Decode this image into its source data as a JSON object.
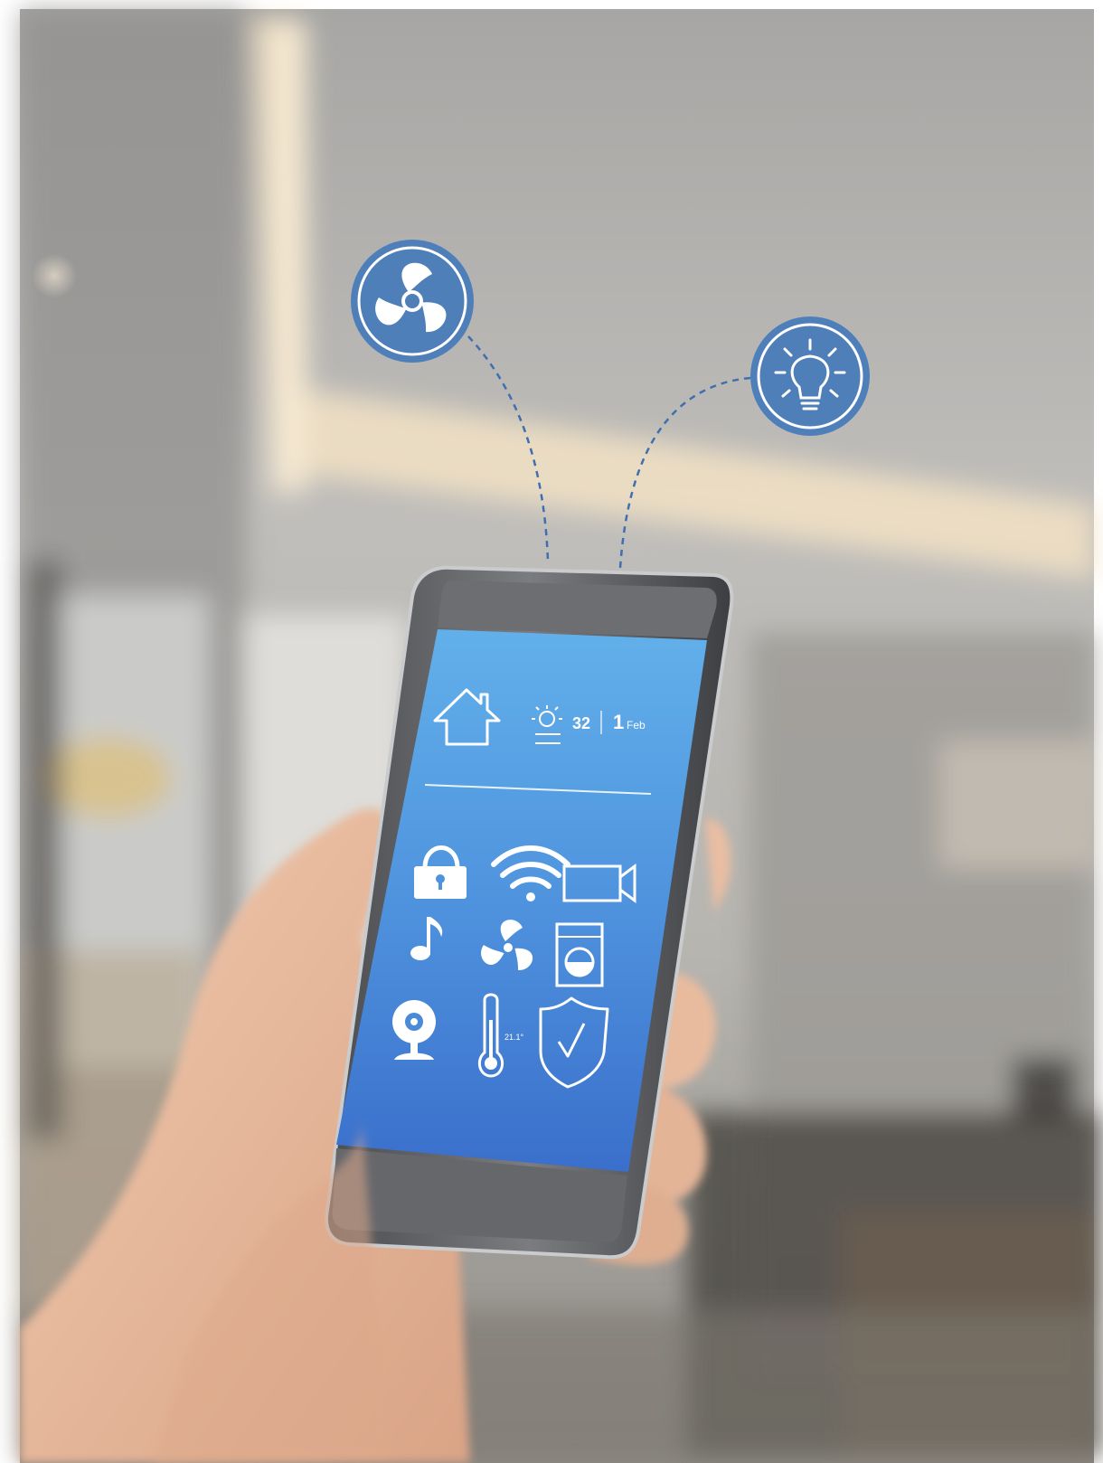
{
  "scene": {
    "description_free": true,
    "colors": {
      "background_wall": "#b8b6b1",
      "ceiling_glow": "#f4e7cf",
      "accent_blue": "#4f7fb8",
      "screen_top": "#5ba7e4",
      "screen_bottom": "#3d78d2",
      "phone_frame": "#5e6064",
      "skin": "#e6b99e"
    }
  },
  "floating_icons": [
    {
      "name": "fan-icon"
    },
    {
      "name": "lightbulb-icon"
    }
  ],
  "phone": {
    "status": {
      "weather_icon": "sun-icon",
      "temperature": "32",
      "day": "1",
      "month": "Feb"
    },
    "grid_icons": [
      "lock-icon",
      "wifi-icon",
      "video-camera-icon",
      "music-note-icon",
      "fan-icon",
      "washing-machine-icon",
      "webcam-icon",
      "thermometer-icon",
      "shield-check-icon"
    ],
    "thermometer_reading": "21.1°"
  }
}
